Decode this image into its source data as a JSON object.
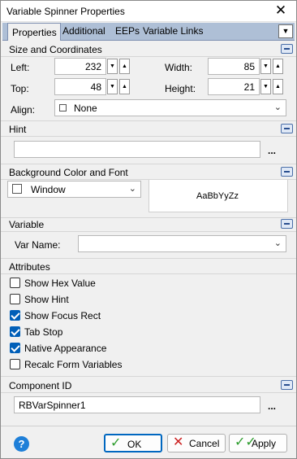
{
  "window": {
    "title": "Variable Spinner Properties"
  },
  "tabs": [
    {
      "label": "Properties"
    },
    {
      "label": "Additional"
    },
    {
      "label": "EEPs"
    },
    {
      "label": "Variable Links"
    }
  ],
  "size": {
    "header": "Size and Coordinates",
    "left_label": "Left:",
    "left_value": "232",
    "top_label": "Top:",
    "top_value": "48",
    "width_label": "Width:",
    "width_value": "85",
    "height_label": "Height:",
    "height_value": "21",
    "align_label": "Align:",
    "align_value": "None"
  },
  "hint": {
    "header": "Hint",
    "value": "",
    "ellipsis": "..."
  },
  "background": {
    "header": "Background Color and Font",
    "color_value": "Window",
    "preview_text": "AaBbYyZz"
  },
  "variable": {
    "header": "Variable",
    "var_name_label": "Var Name:",
    "var_name_value": ""
  },
  "attributes": {
    "header": "Attributes",
    "items": [
      {
        "label": "Show Hex Value",
        "checked": false
      },
      {
        "label": "Show Hint",
        "checked": false
      },
      {
        "label": "Show Focus Rect",
        "checked": true
      },
      {
        "label": "Tab Stop",
        "checked": true
      },
      {
        "label": "Native Appearance",
        "checked": true
      },
      {
        "label": "Recalc Form Variables",
        "checked": false
      }
    ]
  },
  "component": {
    "header": "Component ID",
    "value": "RBVarSpinner1",
    "ellipsis": "..."
  },
  "buttons": {
    "ok": "OK",
    "cancel": "Cancel",
    "apply": "Apply",
    "help": "?"
  },
  "colors": {
    "accent": "#005fb8",
    "tabbar": "#aebfd6",
    "ok_icon": "#2e9d2e",
    "cancel_icon": "#cc2222"
  }
}
